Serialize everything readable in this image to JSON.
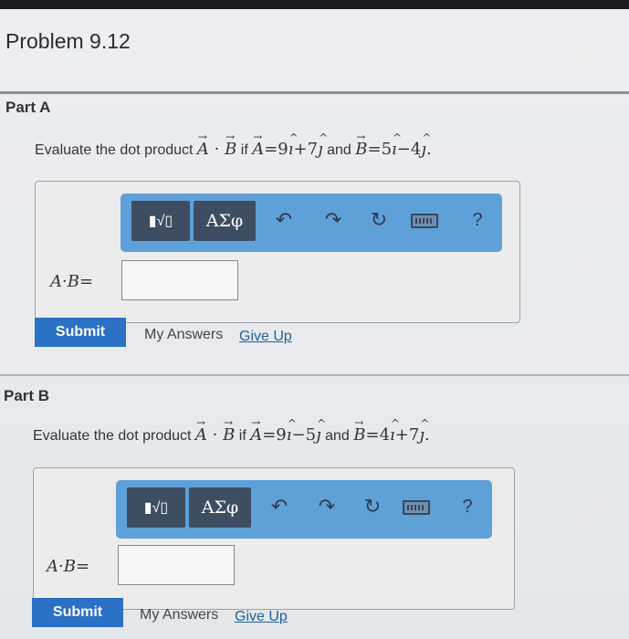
{
  "problem": {
    "title": "Problem 9.12"
  },
  "toolbar": {
    "templates_label": "▮√▯",
    "symbols_label": "ΑΣφ",
    "undo_icon": "↶",
    "redo_icon": "↷",
    "reset_icon": "↻",
    "keyboard_icon": "keyboard-icon",
    "help_label": "?"
  },
  "parts": [
    {
      "label": "Part A",
      "question_prefix": "Evaluate the dot product ",
      "if_text": " if ",
      "and_text": " and ",
      "A_coeffs": [
        "9",
        "+",
        "7"
      ],
      "B_coeffs": [
        "5",
        "−",
        "4"
      ],
      "answer_label": "A·B=",
      "input_value": "",
      "submit_label": "Submit",
      "my_answers_label": "My Answers",
      "give_up_label": "Give Up"
    },
    {
      "label": "Part B",
      "question_prefix": "Evaluate the dot product ",
      "if_text": " if ",
      "and_text": " and ",
      "A_coeffs": [
        "9",
        "−",
        "5"
      ],
      "B_coeffs": [
        "4",
        "+",
        "7"
      ],
      "answer_label": "A·B=",
      "input_value": "",
      "submit_label": "Submit",
      "my_answers_label": "My Answers",
      "give_up_label": "Give Up"
    }
  ],
  "colors": {
    "submit": "#2a70c4",
    "toolbar": "#5ea0d8",
    "toolbar_group": "#3d4d62",
    "link": "#1f5f9e"
  }
}
